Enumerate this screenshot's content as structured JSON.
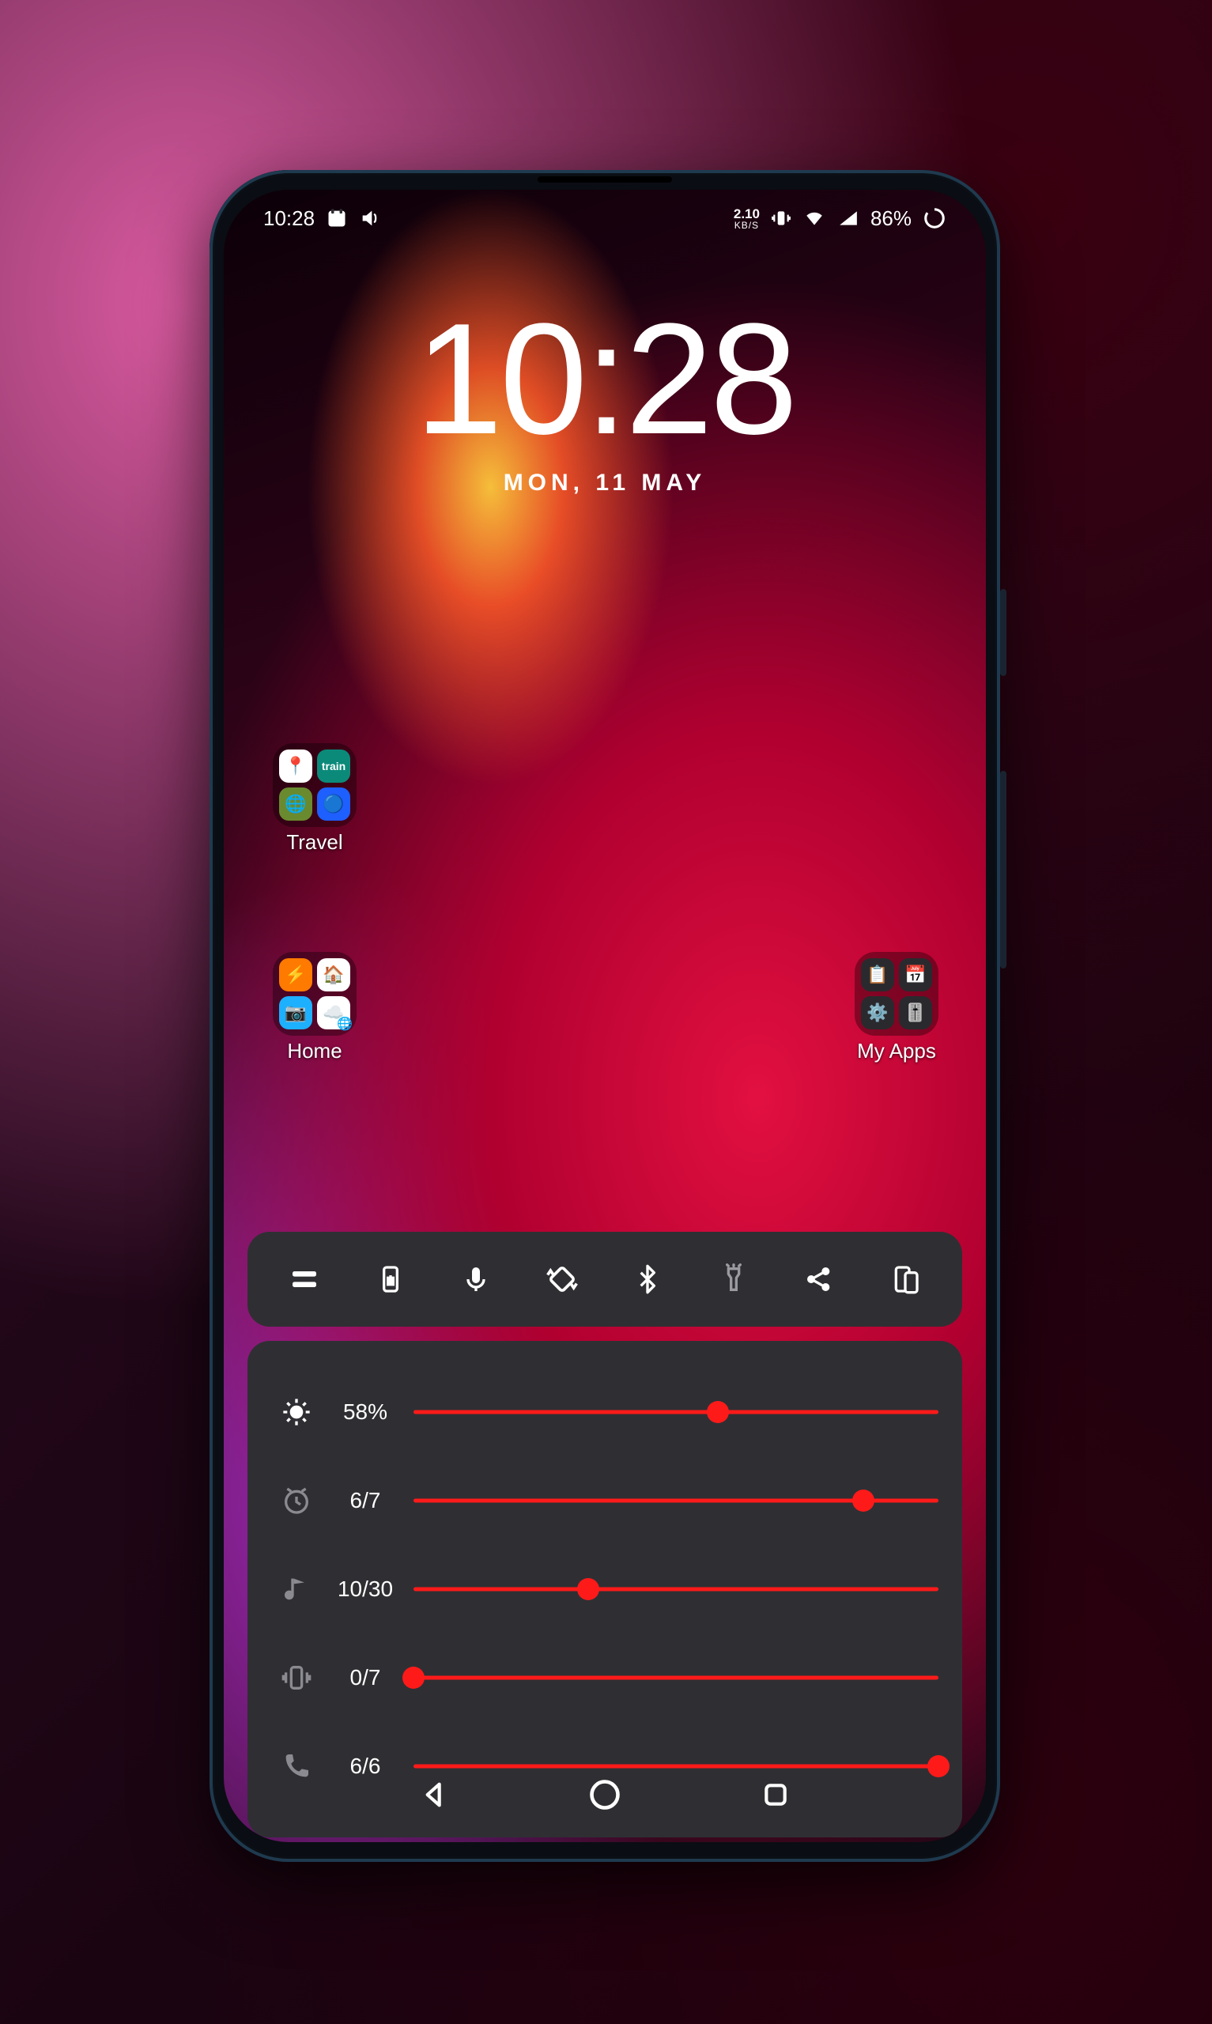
{
  "statusbar": {
    "time": "10:28",
    "data_rate_value": "2.10",
    "data_rate_unit": "KB/S",
    "battery_text": "86%"
  },
  "clock": {
    "time": "10:28",
    "date": "MON, 11 MAY"
  },
  "folders": {
    "travel_label": "Travel",
    "home_label": "Home",
    "myapps_label": "My Apps"
  },
  "sliders": {
    "brightness": {
      "label": "58%",
      "value": 58,
      "max": 100
    },
    "alarm": {
      "label": "6/7",
      "value": 6,
      "max": 7
    },
    "media": {
      "label": "10/30",
      "value": 10,
      "max": 30
    },
    "ring": {
      "label": "0/7",
      "value": 0,
      "max": 7
    },
    "call": {
      "label": "6/6",
      "value": 6,
      "max": 6
    }
  },
  "colors": {
    "accent": "#ff1a1a",
    "panel": "#2f2f33"
  }
}
